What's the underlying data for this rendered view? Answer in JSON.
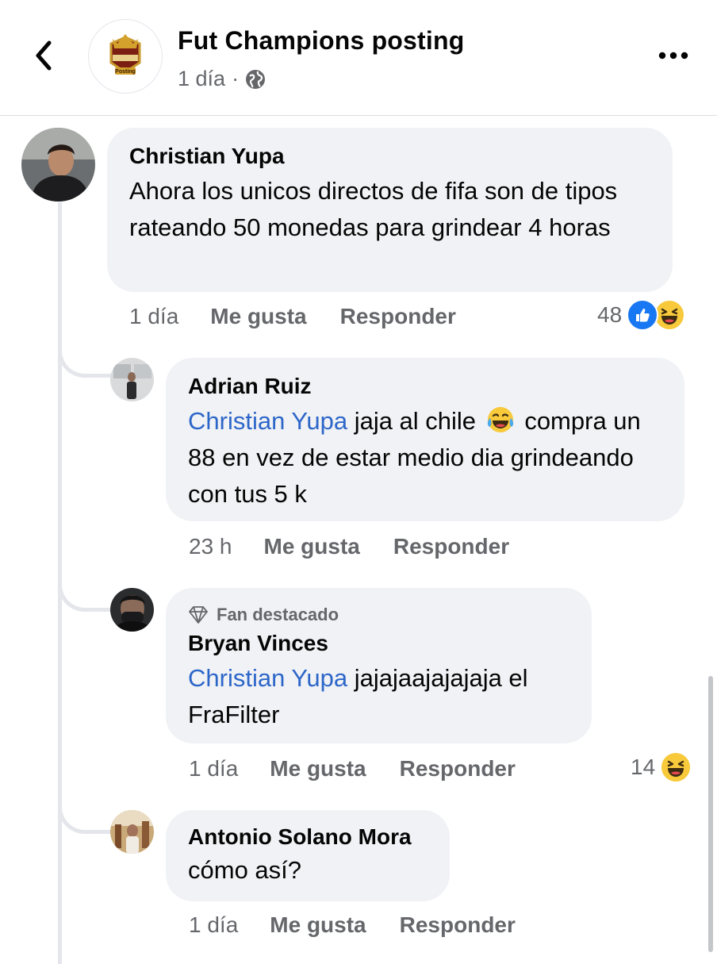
{
  "header": {
    "page_name": "Fut Champions posting",
    "post_time": "1 día",
    "separator": "·",
    "logo_text": "Posting"
  },
  "comments": [
    {
      "author": "Christian Yupa",
      "text": "Ahora los unicos directos de fifa son de tipos rateando 50 monedas para grindear 4 horas",
      "time": "1 día",
      "like_label": "Me gusta",
      "reply_label": "Responder",
      "reaction_count": "48",
      "reactions": [
        "like-icon",
        "haha-icon"
      ]
    },
    {
      "author": "Adrian Ruiz",
      "mention": "Christian Yupa",
      "text_before_emoji": "jaja al chile",
      "emoji": "tears-of-joy-icon",
      "text_after_emoji": "compra un 88 en vez de estar medio dia grindeando con tus 5 k",
      "time": "23 h",
      "like_label": "Me gusta",
      "reply_label": "Responder"
    },
    {
      "badge": "Fan destacado",
      "author": "Bryan Vinces",
      "mention": "Christian Yupa",
      "text": "jajajaajajajaja el FraFilter",
      "time": "1 día",
      "like_label": "Me gusta",
      "reply_label": "Responder",
      "reaction_count": "14",
      "reactions": [
        "haha-icon"
      ]
    },
    {
      "author": "Antonio Solano Mora",
      "text": "cómo así?",
      "time": "1 día",
      "like_label": "Me gusta",
      "reply_label": "Responder"
    }
  ],
  "colors": {
    "mention": "#2d66c9",
    "bubble": "#f0f2f5",
    "secondary_text": "#65676b",
    "like_blue": "#1877f2",
    "haha_yellow": "#f7c93b"
  }
}
